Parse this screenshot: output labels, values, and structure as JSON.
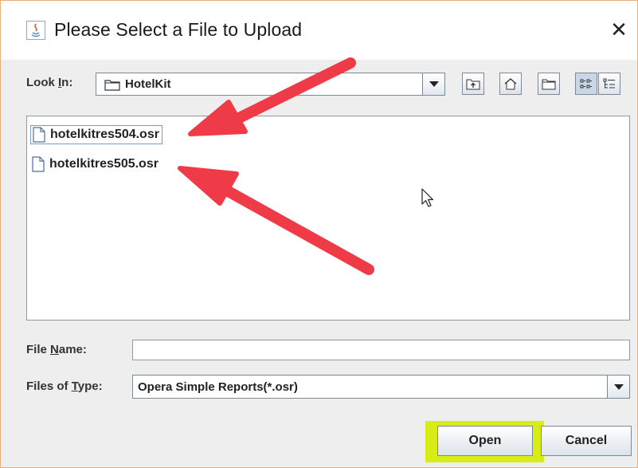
{
  "window": {
    "title": "Please Select a File to Upload",
    "close_glyph": "✕"
  },
  "look_in": {
    "label_pre": "Look ",
    "label_mnemonic": "I",
    "label_post": "n:",
    "value": "HotelKit"
  },
  "toolbar": {
    "buttons": [
      {
        "name": "up-one-level-icon"
      },
      {
        "name": "home-icon"
      },
      {
        "name": "new-folder-icon"
      },
      {
        "name": "list-view-icon",
        "active": true
      },
      {
        "name": "details-view-icon"
      }
    ]
  },
  "files": [
    {
      "name": "hotelkitres504.osr",
      "selected": true
    },
    {
      "name": "hotelkitres505.osr",
      "selected": false
    }
  ],
  "file_name": {
    "label_pre": "File ",
    "label_mnemonic": "N",
    "label_post": "ame:",
    "value": ""
  },
  "file_type": {
    "label_pre": "Files of ",
    "label_mnemonic": "T",
    "label_post": "ype:",
    "value": "Opera Simple Reports(*.osr)"
  },
  "buttons": {
    "open": "Open",
    "cancel": "Cancel"
  },
  "colors": {
    "annotation_arrow": "#ef3b47",
    "highlight": "#d8ed18",
    "window_border": "#e8b07a"
  }
}
